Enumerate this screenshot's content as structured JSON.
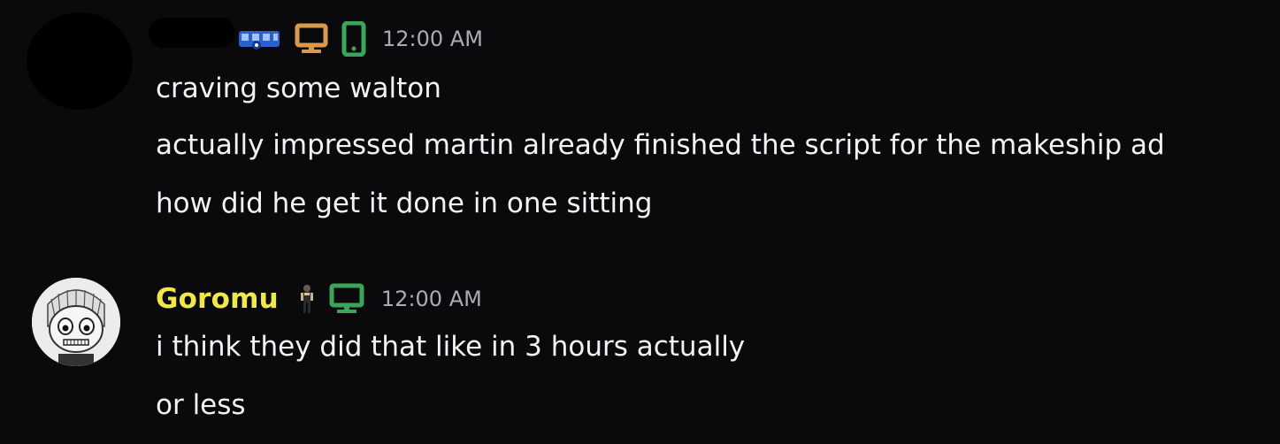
{
  "messages": [
    {
      "author": "",
      "timestamp": "12:00 AM",
      "badges": [
        "blue-mascot-icon",
        "desktop-icon-orange",
        "mobile-icon-green"
      ],
      "lines": [
        "craving some walton",
        "actually impressed martin already finished the script for the makeship ad",
        "how did he get it done in one sitting"
      ]
    },
    {
      "author": "Goromu",
      "author_color": "#f0e84a",
      "timestamp": "12:00 AM",
      "badges": [
        "character-figure-icon",
        "desktop-icon-green"
      ],
      "lines": [
        "i think they did that like in 3 hours actually",
        "or less"
      ]
    }
  ],
  "colors": {
    "background": "#0a0a0d",
    "text": "#f2f3f5",
    "timestamp": "#a9acb3",
    "desktop_orange": "#d89a4e",
    "status_green": "#3ba55c",
    "mascot_blue": "#3a6fd8"
  }
}
